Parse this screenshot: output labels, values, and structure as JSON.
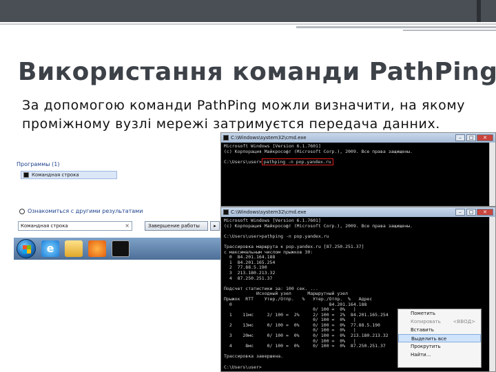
{
  "slide": {
    "title": "Використання команди PathPing",
    "body": "За допомогою команди PathPing можли визначити, на якому проміжному вузлі мережі затримуєтся передача данних."
  },
  "startmenu": {
    "section_programs": "Программы (1)",
    "program_item": "Командная строка",
    "see_more": "Ознакомиться с другими результатами",
    "search_value": "Командная строка",
    "shutdown_label": "Завершение работы"
  },
  "cmd1": {
    "title": "C:\\Windows\\system32\\cmd.exe",
    "line1": "Microsoft Windows [Version 6.1.7601]",
    "line2": "(c) Корпорация Майкрософт (Microsoft Corp.), 2009. Все права защищены.",
    "prompt": "C:\\Users\\user>",
    "command": "pathping -n pop.yandex.ru"
  },
  "cmd2": {
    "title": "C:\\Windows\\system32\\cmd.exe",
    "output": "Microsoft Windows [Version 6.1.7601]\n(c) Корпорация Майкрософт (Microsoft Corp.), 2009. Все права защищены.\n\nC:\\Users\\user>pathping -n pop.yandex.ru\n\nТрассировка маршрута к pop.yandex.ru [87.250.251.37]\nс максимальным числом прыжков 30:\n  0  84.201.164.188\n  1  84.201.165.254\n  2  77.88.5.190\n  3  213.180.213.32\n  4  87.250.251.37\n\nПодсчет статистики за: 100 сек. ...\n            Исходный узел      Маршрутный узел\nПрыжок  RTT    Утер./Отпр.   %   Утер./Отпр.  %   Адрес\n  0                                    84.201.164.188\n                                 0/ 100 =  0%   |\n  1    11мс     2/ 100 =  2%     2/ 100 =  2%  84.201.165.254\n                                 0/ 100 =  0%   |\n  2    13мс     0/ 100 =  0%     0/ 100 =  0%  77.88.5.190\n                                 0/ 100 =  0%   |\n  3    20мс     0/ 100 =  0%     0/ 100 =  0%  213.180.213.32\n                                 0/ 100 =  0%   |\n  4     8мс     0/ 100 =  0%     0/ 100 =  0%  87.250.251.37\n\nТрассировка завершена.\n\nC:\\Users\\user>"
  },
  "context_menu": {
    "items": [
      "Пометить",
      "Копировать",
      "Вставить",
      "Выделить все",
      "Прокрутить",
      "Найти..."
    ],
    "copy_shortcut": "<ВВОД>"
  }
}
